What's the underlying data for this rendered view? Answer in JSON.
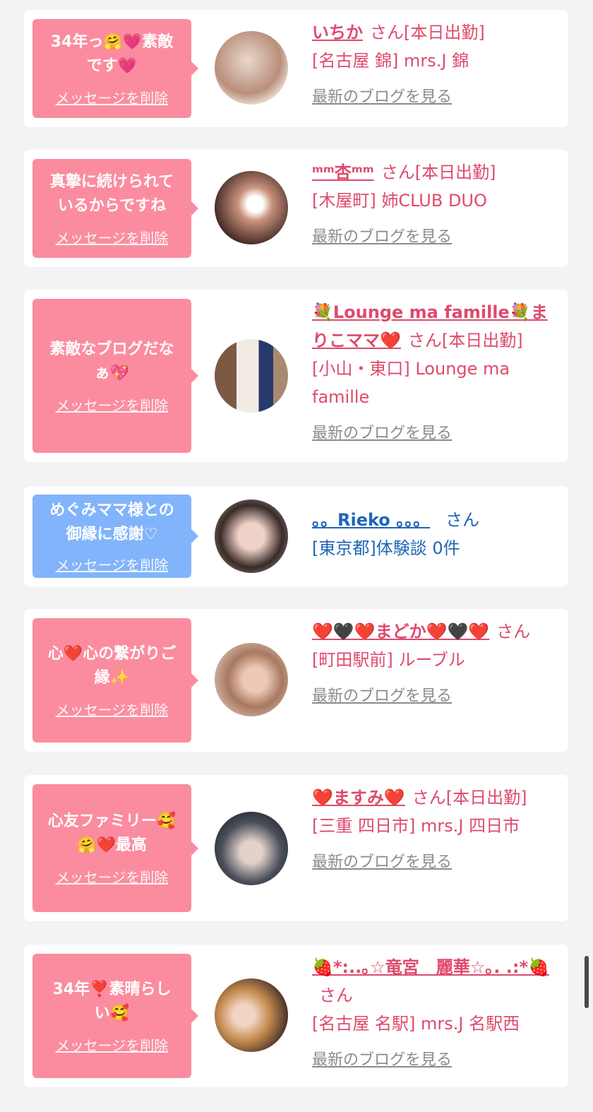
{
  "cards": [
    {
      "message": "34年っ🤗💗素敵\nです💗",
      "delete_label": "メッセージを削除",
      "name": "いちか",
      "suffix": "さん[本日出勤]",
      "shop": "[名古屋 錦] mrs.J 錦",
      "blog_label": "最新のブログを見る"
    },
    {
      "message": "真摯に続けられて\nいるからですね",
      "delete_label": "メッセージを削除",
      "name": "ᵐᵐ杏ᵐᵐ",
      "suffix": "さん[本日出勤]",
      "shop": "[木屋町] 姉CLUB DUO",
      "blog_label": "最新のブログを見る"
    },
    {
      "message": "素敵なブログだな\nぁ💖",
      "delete_label": "メッセージを削除",
      "name": "💐Lounge ma famille💐まりこママ❤️",
      "suffix": "さん[本日出勤]",
      "shop": "[小山・東口] Lounge ma famille",
      "blog_label": "最新のブログを見る"
    },
    {
      "message": "めぐみママ様との\n御縁に感謝♡",
      "delete_label": "メッセージを削除",
      "name": "。。Rieko 。。。",
      "suffix": "さん",
      "shop": "[東京都]体験談 0件",
      "blog_label": ""
    },
    {
      "message": "心❤️心の繋がりご\n縁✨",
      "delete_label": "メッセージを削除",
      "name": "❤️🖤❤️まどか❤️🖤❤️",
      "suffix": "さん",
      "shop": "[町田駅前] ルーブル",
      "blog_label": "最新のブログを見る"
    },
    {
      "message": "心友ファミリー🥰\n🤗❤️最高",
      "delete_label": "メッセージを削除",
      "name": "❤️ますみ❤️",
      "suffix": "さん[本日出勤]",
      "shop": "[三重 四日市] mrs.J 四日市",
      "blog_label": "最新のブログを見る"
    },
    {
      "message": "34年❣️素晴らし\nい🥰",
      "delete_label": "メッセージを削除",
      "name": "🍓*:..｡☆竜宮　麗華☆｡. .:*🍓",
      "suffix": "さん",
      "shop": "[名古屋 名駅] mrs.J 名駅西",
      "blog_label": "最新のブログを見る"
    }
  ]
}
